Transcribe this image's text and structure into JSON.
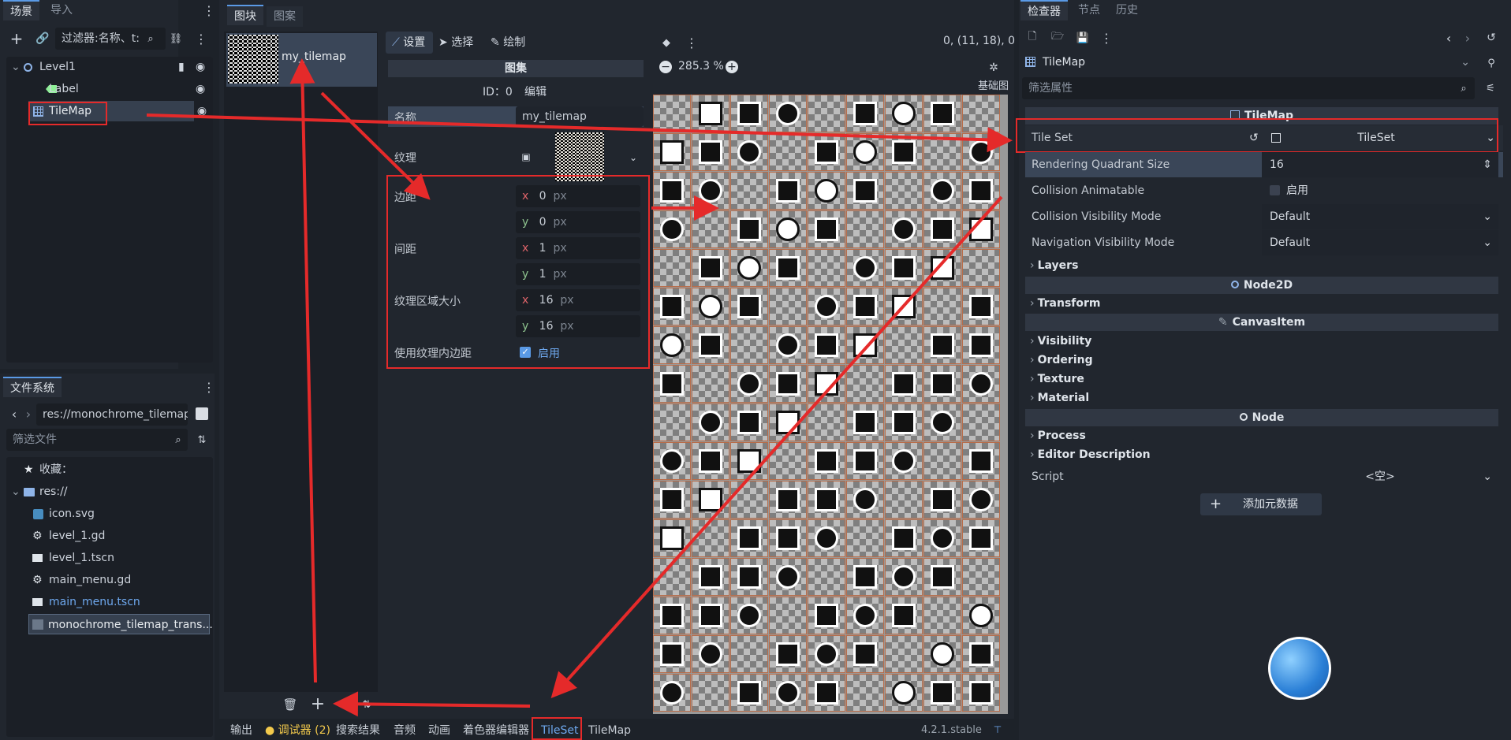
{
  "scene_panel": {
    "tab_scene": "场景",
    "tab_import": "导入",
    "filter_placeholder": "过滤器:名称、t:",
    "nodes": [
      {
        "name": "Level1"
      },
      {
        "name": "Label"
      },
      {
        "name": "TileMap"
      }
    ]
  },
  "filesystem": {
    "title": "文件系统",
    "path": "res://monochrome_tilemap",
    "filter_placeholder": "筛选文件",
    "items": [
      {
        "label": "收藏："
      },
      {
        "label": "res://"
      },
      {
        "label": "icon.svg"
      },
      {
        "label": "level_1.gd"
      },
      {
        "label": "level_1.tscn"
      },
      {
        "label": "main_menu.gd"
      },
      {
        "label": "main_menu.tscn"
      },
      {
        "label": "monochrome_tilemap_trans..."
      }
    ]
  },
  "tileset_editor": {
    "tab_tiles": "图块",
    "tab_patterns": "图案",
    "source_name": "my_tilemap",
    "mode_setup": "设置",
    "mode_select": "选择",
    "mode_paint": "绘制",
    "coords": "0, (11, 18), 0",
    "zoom": "285.3 %",
    "base_tiles": "基础图",
    "atlas_header": "图集",
    "id_label": "ID：0",
    "edit_label": "编辑",
    "props": {
      "name_label": "名称",
      "name_value": "my_tilemap",
      "texture_label": "纹理",
      "margin_label": "边距",
      "sep_label": "间距",
      "region_label": "纹理区域大小",
      "padding_label": "使用纹理内边距",
      "enabled": "启用",
      "x": "x",
      "y": "y",
      "unit": "px",
      "margin_x": "0",
      "margin_y": "0",
      "sep_x": "1",
      "sep_y": "1",
      "region_x": "16",
      "region_y": "16"
    }
  },
  "bottom_bar": {
    "output": "输出",
    "debugger": "调试器 (2)",
    "search": "搜索结果",
    "audio": "音频",
    "animation": "动画",
    "shader": "着色器编辑器",
    "tileset": "TileSet",
    "tilemap": "TileMap",
    "version": "4.2.1.stable"
  },
  "inspector": {
    "tab_inspector": "检查器",
    "tab_node": "节点",
    "tab_history": "历史",
    "object": "TileMap",
    "filter_placeholder": "筛选属性",
    "class_header": "TileMap",
    "tile_set_label": "Tile Set",
    "tile_set_value": "TileSet",
    "quadrant_label": "Rendering Quadrant Size",
    "quadrant_value": "16",
    "collision_anim_label": "Collision Animatable",
    "collision_anim_value": "启用",
    "collision_vis_label": "Collision Visibility Mode",
    "collision_vis_value": "Default",
    "nav_vis_label": "Navigation Visibility Mode",
    "nav_vis_value": "Default",
    "layers": "Layers",
    "node2d": "Node2D",
    "transform": "Transform",
    "canvasitem": "CanvasItem",
    "visibility": "Visibility",
    "ordering": "Ordering",
    "texture": "Texture",
    "material": "Material",
    "node": "Node",
    "process": "Process",
    "editor_desc": "Editor Description",
    "script_label": "Script",
    "script_value": "<空>",
    "add_metadata": "添加元数据"
  }
}
